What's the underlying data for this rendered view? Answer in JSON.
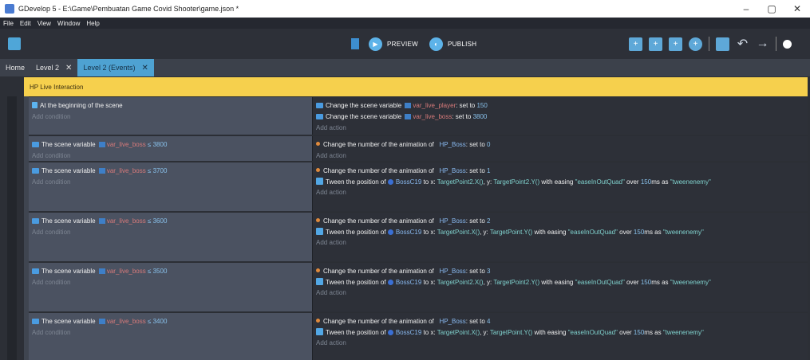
{
  "window": {
    "title": "GDevelop 5 - E:\\Game\\Pembuatan Game Covid Shooter\\game.json *",
    "minimize": "–",
    "maximize": "▢",
    "close": "✕"
  },
  "menu": [
    "File",
    "Edit",
    "View",
    "Window",
    "Help"
  ],
  "toolbar": {
    "preview_label": "PREVIEW",
    "publish_label": "PUBLISH",
    "icons": [
      "add-event-icon",
      "add-subevent-icon",
      "add-comment-icon",
      "add-other-icon",
      "scene-settings-icon",
      "undo-icon",
      "redo-icon",
      "more-icon"
    ]
  },
  "tabs": [
    {
      "label": "Home",
      "closable": false
    },
    {
      "label": "Level 2",
      "closable": true
    },
    {
      "label": "Level 2 (Events)",
      "closable": true
    }
  ],
  "group_name": "HP Live Interaction",
  "placeholders": {
    "add_condition": "Add condition",
    "add_action": "Add action"
  },
  "events": [
    {
      "condition": "At the beginning of the scene",
      "actions": [
        {
          "prefix": "Change the scene variable",
          "var": "var_live_player",
          "rest": ": set to ",
          "value": "150"
        },
        {
          "prefix": "Change the scene variable",
          "var": "var_live_boss",
          "rest": ": set to ",
          "value": "3800"
        }
      ]
    },
    {
      "cond_prefix": "The scene variable",
      "cond_var": "var_live_boss",
      "cond_op": "≤ 3800",
      "anim_object": "HP_Boss",
      "anim_value": "0"
    },
    {
      "cond_prefix": "The scene variable",
      "cond_var": "var_live_boss",
      "cond_op": "≤ 3700",
      "anim_object": "HP_Boss",
      "anim_value": "1",
      "tween": {
        "object": "BossC19",
        "x": "TargetPoint2.X()",
        "y": "TargetPoint2.Y()",
        "easing": "\"easeInOutQuad\"",
        "ms": "150",
        "id": "\"tweenenemy\""
      }
    },
    {
      "cond_prefix": "The scene variable",
      "cond_var": "var_live_boss",
      "cond_op": "≤ 3600",
      "anim_object": "HP_Boss",
      "anim_value": "2",
      "tween": {
        "object": "BossC19",
        "x": "TargetPoint.X()",
        "y": "TargetPoint.Y()",
        "easing": "\"easeInOutQuad\"",
        "ms": "150",
        "id": "\"tweenenemy\""
      }
    },
    {
      "cond_prefix": "The scene variable",
      "cond_var": "var_live_boss",
      "cond_op": "≤ 3500",
      "anim_object": "HP_Boss",
      "anim_value": "3",
      "tween": {
        "object": "BossC19",
        "x": "TargetPoint2.X()",
        "y": "TargetPoint2.Y()",
        "easing": "\"easeInOutQuad\"",
        "ms": "150",
        "id": "\"tweenenemy\""
      }
    },
    {
      "cond_prefix": "The scene variable",
      "cond_var": "var_live_boss",
      "cond_op": "≤ 3400",
      "anim_object": "HP_Boss",
      "anim_value": "4",
      "tween": {
        "object": "BossC19",
        "x": "TargetPoint.X()",
        "y": "TargetPoint.Y()",
        "easing": "\"easeInOutQuad\"",
        "ms": "150",
        "id": "\"tweenenemy\""
      }
    }
  ],
  "phrases": {
    "anim_prefix": "Change the number of the animation of",
    "anim_mid": ": set to ",
    "tween_prefix": "Tween the position of",
    "tween_x": "to x:",
    "tween_y": ", y:",
    "tween_easing": "with easing",
    "tween_over": "over",
    "tween_ms": "ms as"
  }
}
